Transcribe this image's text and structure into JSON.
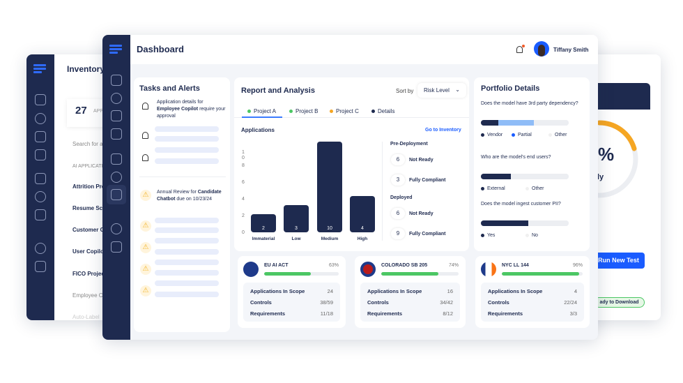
{
  "inventory_window": {
    "title": "Inventory",
    "count": "27",
    "count_label": "APP",
    "search_placeholder": "Search for a",
    "column_header": "AI APPLICATI",
    "rows": [
      "Attrition Pre",
      "Resume Scr",
      "Customer C",
      "User Copilo",
      "FICO Projec",
      "Employee C",
      "Auto-Label"
    ]
  },
  "right_window": {
    "gauge_text": "%",
    "gauge_sub": "ly",
    "run_button": "Run New Test",
    "status_pill": "ady to Download",
    "gauge_color": "#f5a623"
  },
  "header": {
    "title": "Dashboard",
    "user_name": "Tiffany Smith"
  },
  "tasks": {
    "title": "Tasks and Alerts",
    "alert1": {
      "pre": "Application details for ",
      "bold": "Employee Copilot",
      "post": " require your approval"
    },
    "alert2": {
      "pre": "Annual Review for ",
      "bold": "Candidate Chatbot",
      "post": " due on 10/23/24"
    }
  },
  "report": {
    "title": "Report and Analysis",
    "sort_label": "Sort by",
    "sort_value": "Risk Level",
    "tabs": [
      {
        "label": "Project A",
        "color": "#4cc764"
      },
      {
        "label": "Project B",
        "color": "#4cc764"
      },
      {
        "label": "Project C",
        "color": "#f5a623"
      },
      {
        "label": "Details",
        "color": "#1e2a4f"
      }
    ],
    "section_title": "Applications",
    "link": "Go to Inventory",
    "pre_deployment": {
      "title": "Pre-Deployment",
      "items": [
        {
          "n": "6",
          "label": "Not Ready"
        },
        {
          "n": "3",
          "label": "Fully Compliant"
        }
      ]
    },
    "deployed": {
      "title": "Deployed",
      "items": [
        {
          "n": "6",
          "label": "Not Ready"
        },
        {
          "n": "9",
          "label": "Fully Compliant"
        }
      ]
    }
  },
  "chart_data": {
    "type": "bar",
    "categories": [
      "Immaterial",
      "Low",
      "Medium",
      "High"
    ],
    "values": [
      2,
      3,
      10,
      4
    ],
    "yticks": [
      "0",
      "2",
      "4",
      "6",
      "8",
      "1\n0"
    ],
    "ylim": [
      0,
      10
    ],
    "color": "#1e2a4f"
  },
  "portfolio": {
    "title": "Portfolio Details",
    "questions": [
      {
        "q": "Does the model have 3rd party dependency?",
        "segments": [
          {
            "label": "Vendor",
            "value": 20,
            "color": "#1e2a4f"
          },
          {
            "label": "Partial",
            "value": 40,
            "color": "#8fbcf7"
          },
          {
            "label": "Other",
            "value": 40,
            "color": "#eceef2"
          }
        ]
      },
      {
        "q": "Who are the model's end users?",
        "segments": [
          {
            "label": "External",
            "value": 34,
            "color": "#1e2a4f"
          },
          {
            "label": "Other",
            "value": 66,
            "color": "#eceef2"
          }
        ]
      },
      {
        "q": "Does the model ingest customer PII?",
        "segments": [
          {
            "label": "Yes",
            "value": 54,
            "color": "#1e2a4f"
          },
          {
            "label": "No",
            "value": 46,
            "color": "#eceef2"
          }
        ]
      }
    ]
  },
  "regulations": [
    {
      "name": "EU AI ACT",
      "percent": "63%",
      "progress": 63,
      "apps_label": "Applications In Scope",
      "apps": "24",
      "controls_label": "Controls",
      "controls": "38/59",
      "req_label": "Requirements",
      "req": "11/18"
    },
    {
      "name": "COLORADO SB 205",
      "percent": "74%",
      "progress": 74,
      "apps_label": "Applications In Scope",
      "apps": "16",
      "controls_label": "Controls",
      "controls": "34/42",
      "req_label": "Requirements",
      "req": "8/12"
    },
    {
      "name": "NYC LL 144",
      "percent": "96%",
      "progress": 96,
      "apps_label": "Applications In Scope",
      "apps": "4",
      "controls_label": "Controls",
      "controls": "22/24",
      "req_label": "Requirements",
      "req": "3/3"
    }
  ]
}
